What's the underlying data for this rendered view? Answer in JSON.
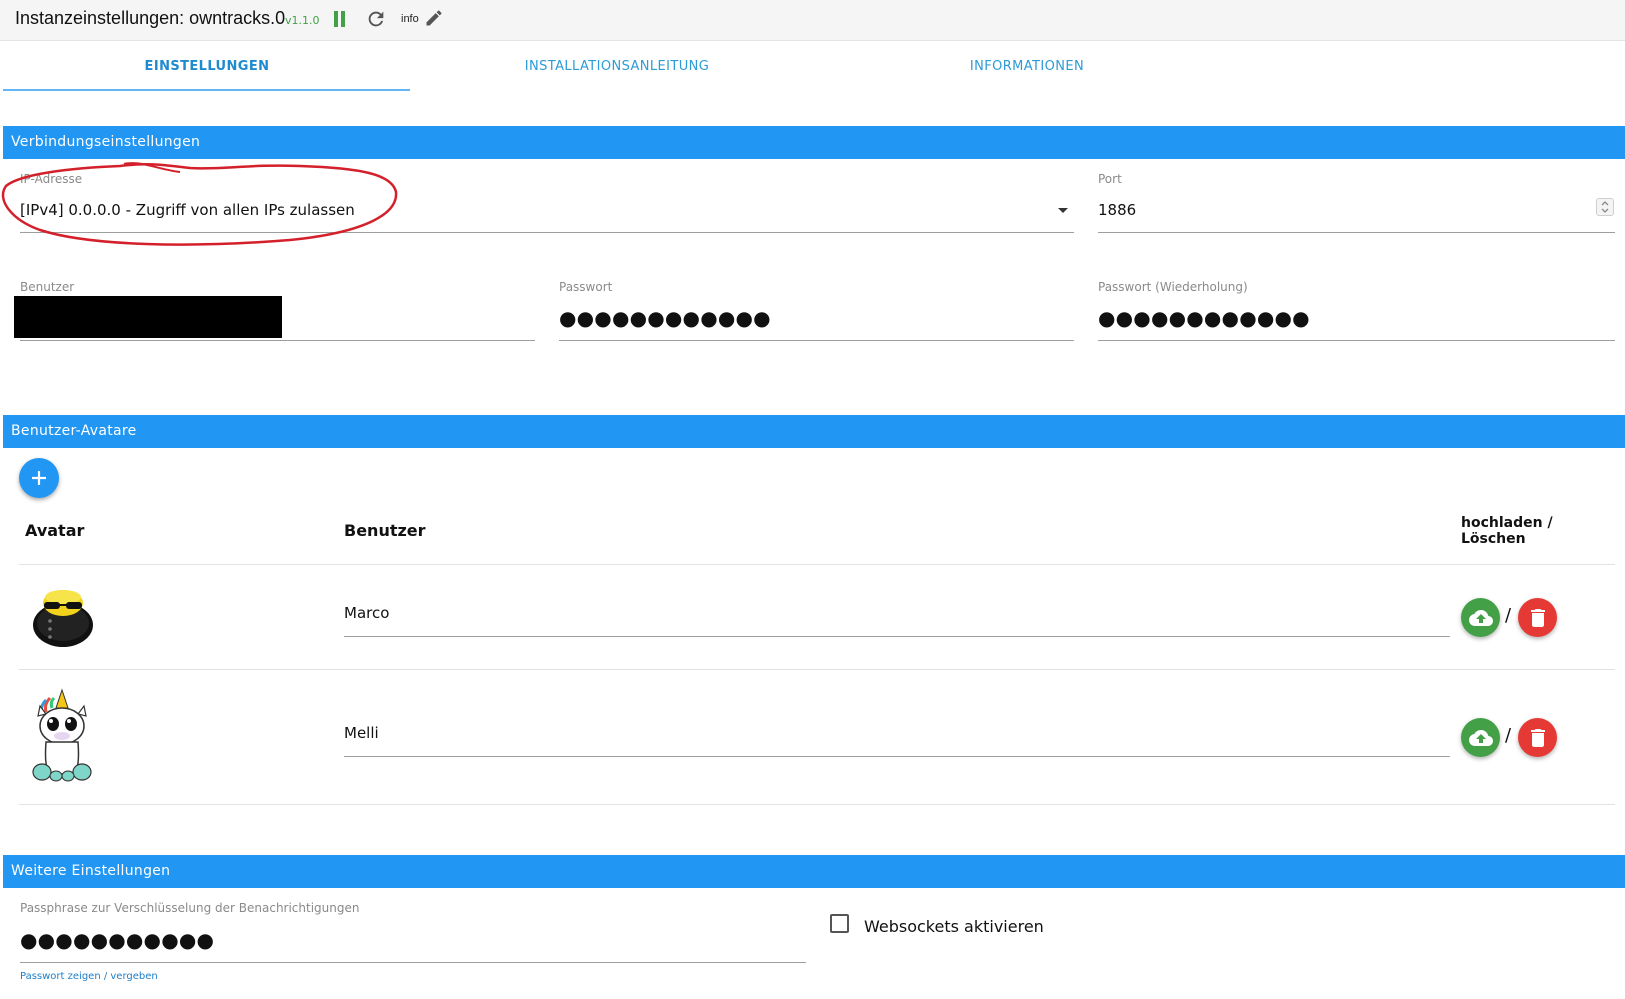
{
  "window": {
    "title": "Instanzeinstellungen: owntracks.0",
    "version": "v1.1.0",
    "info_label": "info",
    "icons": [
      "pause-icon",
      "reload-icon",
      "edit-icon"
    ]
  },
  "tabs": [
    {
      "label": "EINSTELLUNGEN",
      "active": true
    },
    {
      "label": "INSTALLATIONSANLEITUNG",
      "active": false
    },
    {
      "label": "INFORMATIONEN",
      "active": false
    }
  ],
  "connection": {
    "header": "Verbindungseinstellungen",
    "ip": {
      "label": "IP-Adresse",
      "value": "[IPv4] 0.0.0.0 - Zugriff von allen IPs zulassen"
    },
    "port": {
      "label": "Port",
      "value": "1886"
    },
    "user": {
      "label": "Benutzer"
    },
    "password": {
      "label": "Passwort",
      "value": "●●●●●●●●●●●●"
    },
    "password_repeat": {
      "label": "Passwort (Wiederholung)",
      "value": "●●●●●●●●●●●●"
    }
  },
  "avatars": {
    "header": "Benutzer-Avatare",
    "add_icon": "plus-icon",
    "columns": {
      "avatar": "Avatar",
      "user": "Benutzer",
      "actions_line1": "hochladen /",
      "actions_line2": "Löschen"
    },
    "rows": [
      {
        "user": "Marco",
        "avatar_icon": "sunglasses-smiley-icon"
      },
      {
        "user": "Melli",
        "avatar_icon": "unicorn-icon"
      }
    ],
    "separator": "/",
    "colors": {
      "upload": "#43a047",
      "delete": "#e53935",
      "accent": "#2196f3"
    }
  },
  "further": {
    "header": "Weitere Einstellungen",
    "passphrase": {
      "label": "Passphrase zur Verschlüsselung der Benachrichtigungen",
      "value": "●●●●●●●●●●●"
    },
    "show_password_link": "Passwort zeigen / vergeben",
    "websockets": {
      "label": "Websockets aktivieren",
      "checked": false
    }
  }
}
